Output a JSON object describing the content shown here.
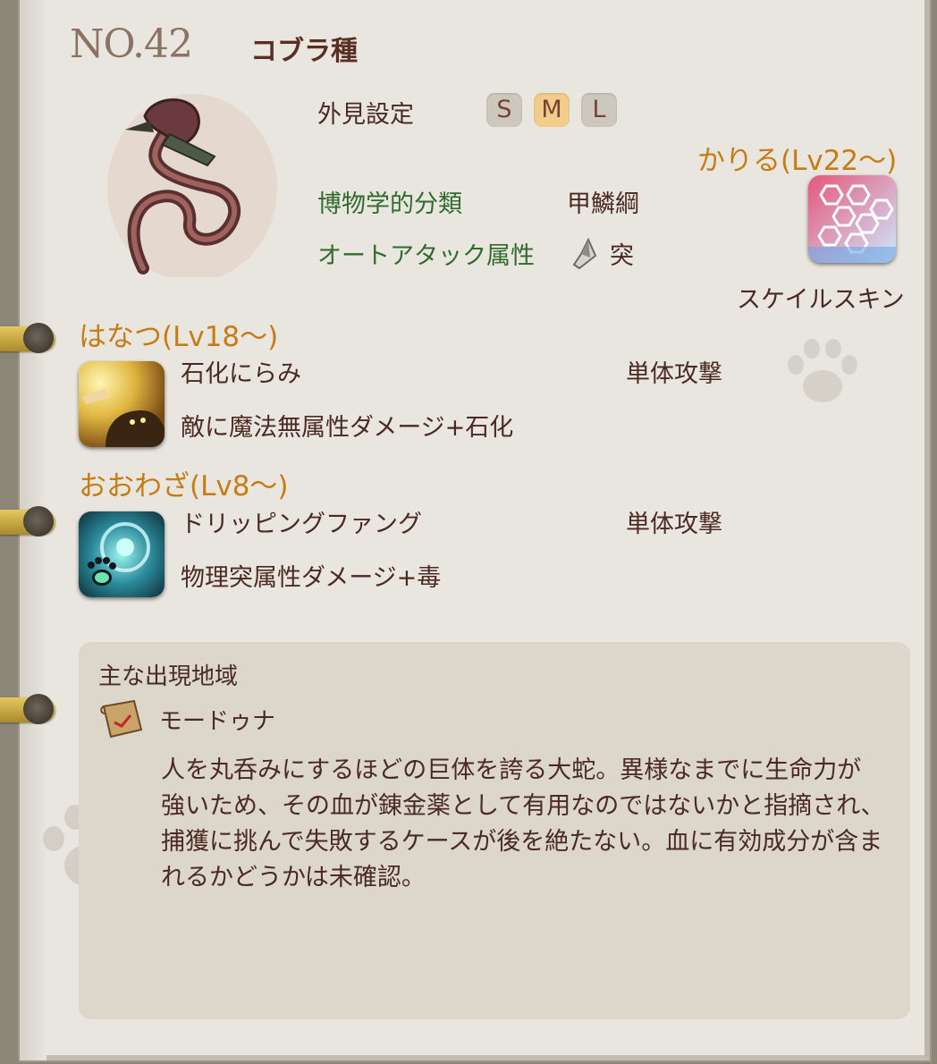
{
  "header": {
    "number": "NO.42",
    "name": "コブラ種"
  },
  "appearance": {
    "label": "外見設定",
    "sizes": [
      "S",
      "M",
      "L"
    ],
    "selected": "M"
  },
  "info": {
    "classification_label": "博物学的分類",
    "classification_value": "甲鱗綱",
    "autoattack_label": "オートアタック属性",
    "autoattack_value": "突"
  },
  "karu": {
    "header": "かりる(Lv22～)",
    "skill_name": "スケイルスキン"
  },
  "skills": [
    {
      "header": "はなつ(Lv18～)",
      "name": "石化にらみ",
      "type": "単体攻撃",
      "description": "敵に魔法無属性ダメージ+石化"
    },
    {
      "header": "おおわざ(Lv8～)",
      "name": "ドリッピングファング",
      "type": "単体攻撃",
      "description": "物理突属性ダメージ+毒"
    }
  ],
  "habitat": {
    "label": "主な出現地域",
    "region": "モードゥナ",
    "description": "人を丸呑みにするほどの巨体を誇る大蛇。異様なまでに生命力が強いため、その血が錬金薬として有用なのではないかと指摘され、捕獲に挑んで失敗するケースが後を絶たない。血に有効成分が含まれるかどうかは未確認。"
  },
  "colors": {
    "page": "#e9e6df",
    "heading_orange": "#c77b14",
    "green_label": "#2f6b2b",
    "text_brown": "#4a2a23",
    "size_active": "#f2cc8a"
  }
}
